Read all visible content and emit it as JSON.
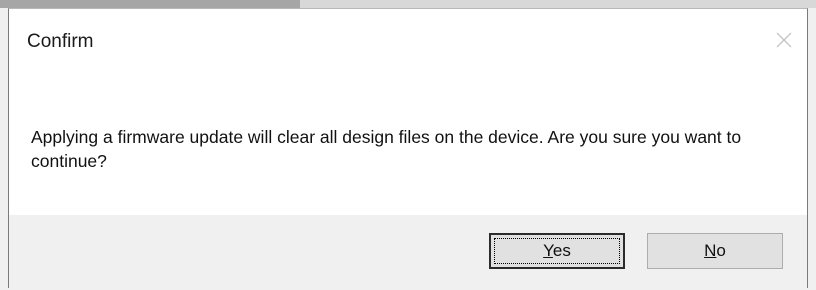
{
  "dialog": {
    "title": "Confirm",
    "message": "Applying a firmware update will clear all design files on the device. Are you sure you want to continue?",
    "close_icon": "close-icon"
  },
  "buttons": {
    "yes": {
      "mnemonic": "Y",
      "rest": "es"
    },
    "no": {
      "mnemonic": "N",
      "rest": "o"
    }
  }
}
